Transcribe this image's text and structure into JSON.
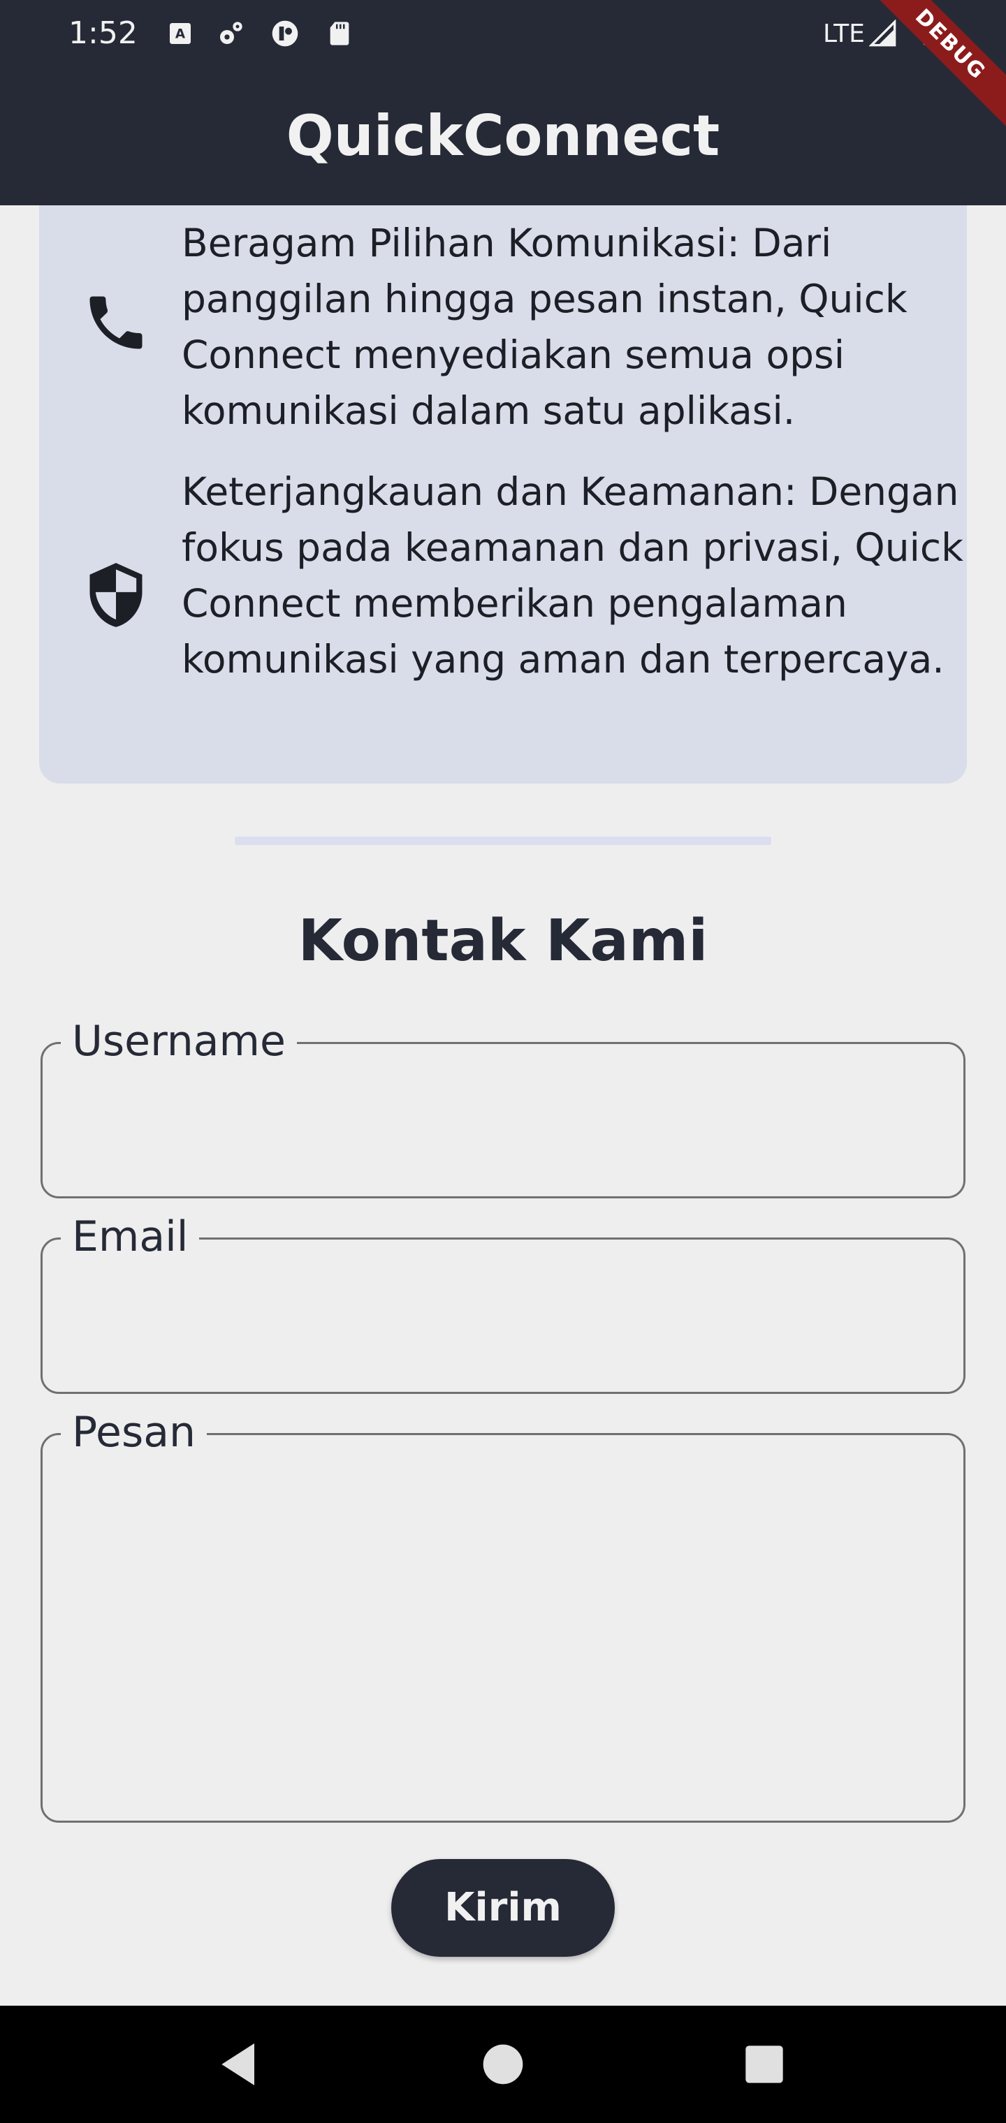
{
  "status_bar": {
    "time": "1:52",
    "network": "LTE",
    "icons": [
      "keyboard-icon",
      "settings-icon",
      "app-icon",
      "sd-card-icon",
      "signal-icon",
      "battery-icon"
    ]
  },
  "debug_banner": "DEBUG",
  "app_bar": {
    "title": "QuickConnect"
  },
  "features": [
    {
      "icon": "phone-icon",
      "text": "Beragam Pilihan Komunikasi: Dari panggilan hingga pesan instan, Quick Connect menyediakan semua opsi komunikasi dalam satu aplikasi."
    },
    {
      "icon": "shield-icon",
      "text": "Keterjangkauan dan Keamanan: Dengan fokus pada keamanan dan privasi, Quick Connect memberikan pengalaman komunikasi yang aman dan terpercaya."
    }
  ],
  "contact": {
    "title": "Kontak Kami",
    "username_label": "Username",
    "email_label": "Email",
    "message_label": "Pesan",
    "username_value": "",
    "email_value": "",
    "message_value": "",
    "submit_label": "Kirim"
  },
  "colors": {
    "app_bar": "#262a37",
    "card": "#d9dde9",
    "background": "#eeeeee",
    "debug": "#8c1c1c"
  },
  "nav_bar": {
    "icons": [
      "back-icon",
      "home-icon",
      "recents-icon"
    ]
  }
}
